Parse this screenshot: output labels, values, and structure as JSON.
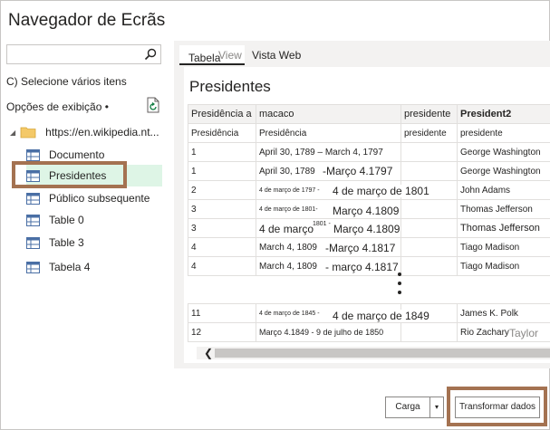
{
  "window": {
    "title": "Navegador de Ecrãs"
  },
  "left_pane": {
    "search_placeholder": "",
    "select_multiple": "C) Selecione vários itens",
    "display_options": "Opções de exibição •",
    "folder": "https://en.wikipedia.nt...",
    "items": [
      {
        "label": "Documento",
        "selected": false
      },
      {
        "label": "Presidentes",
        "selected": true
      },
      {
        "label": "Público subsequente",
        "selected": false
      },
      {
        "label": "Table 0",
        "selected": false
      },
      {
        "label": "Table 3",
        "selected": false
      },
      {
        "label": "Tabela 4",
        "selected": false
      }
    ]
  },
  "preview": {
    "tabs": {
      "table": "Tabela",
      "view_ghost": "View",
      "web_view": "Vista Web"
    },
    "title": "Presidentes",
    "header": [
      "Presidência a",
      "macaco",
      "presidente",
      "President2"
    ],
    "subheader": [
      "Presidência",
      "Presidência",
      "presidente",
      "presidente"
    ],
    "rows": [
      [
        "1",
        "April 30, 1789 – March 4, 1797",
        "",
        "George Washington"
      ],
      [
        "1",
        "April 30, 1789",
        "",
        "George Washington"
      ],
      [
        "2",
        "4 de março de 1797 -",
        "",
        "John Adams"
      ],
      [
        "3",
        "4 de março de 1801-",
        "",
        "Thomas Jefferson"
      ],
      [
        "3",
        "",
        "",
        "Thomas Jefferson"
      ],
      [
        "4",
        "March 4, 1809",
        "",
        "Tiago Madison"
      ],
      [
        "4",
        "March 4, 1809",
        "",
        "Tiago Madison"
      ]
    ],
    "overlays": {
      "r1": "-Março 4.1797",
      "r2": "4 de março de 1801",
      "r3": "Março 4.1809",
      "r4a": "4 de março",
      "r4b": "1801 -",
      "r4c": "Março 4.1809",
      "r5": "-Março 4.1817",
      "r6": "- março 4.1817",
      "r10": "4 de março de 1849",
      "r11b": "Taylor"
    },
    "rows_after": [
      [
        "11",
        "4 de março de 1845 -",
        "",
        "James K. Polk"
      ],
      [
        "12",
        "Março 4.1849 - 9 de julho de 1850",
        "",
        "Rio Zachary"
      ]
    ]
  },
  "footer": {
    "load": "Carga",
    "dropdown": "▾",
    "transform": "Transformar dados"
  },
  "colors": {
    "highlight_box": "#a47251",
    "selected_bg": "#def5e6"
  }
}
